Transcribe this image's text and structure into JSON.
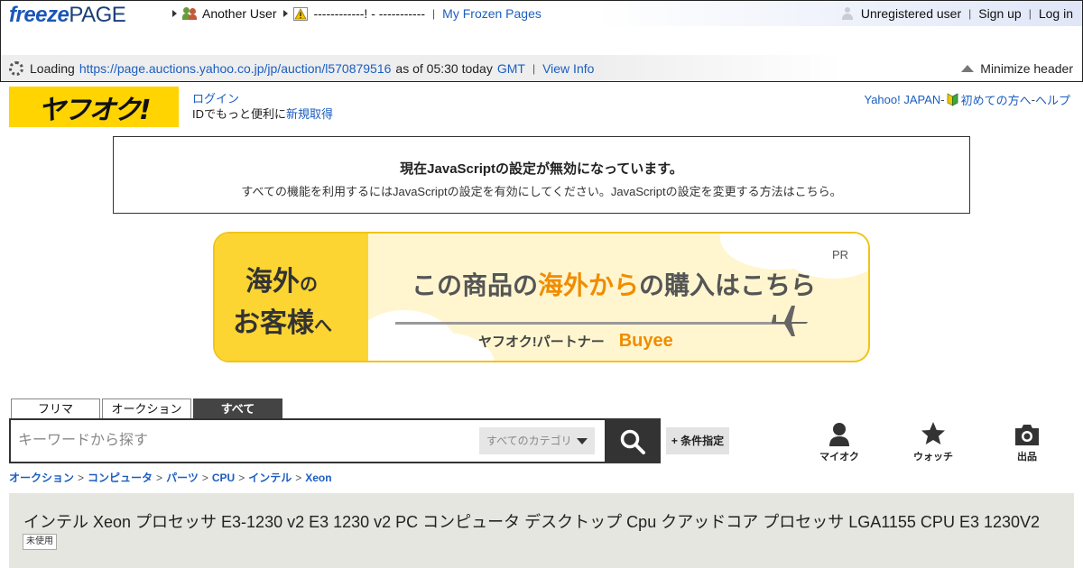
{
  "freezepage": {
    "logo_part1": "freeze",
    "logo_part2": "PAGE",
    "crumbs": {
      "user": "Another User",
      "page": "------------! - -----------",
      "frozen_pages": "My Frozen Pages"
    },
    "account": {
      "status": "Unregistered user",
      "signup": "Sign up",
      "login": "Log in"
    },
    "loading": {
      "prefix": "Loading",
      "url": "https://page.auctions.yahoo.co.jp/jp/auction/l570879516",
      "as_of": "as of 05:30 today",
      "tz": "GMT",
      "view_info": "View Info"
    },
    "minimize": "Minimize header"
  },
  "yahoo": {
    "logo": "ヤフオク!",
    "login_link": "ログイン",
    "login_text": "IDでもっと便利に",
    "register_link": "新規取得",
    "right": {
      "yahoo_japan": "Yahoo! JAPAN",
      "dash1": " - ",
      "beginner": "初めての方へ",
      "dash2": " - ",
      "help": "ヘルプ"
    }
  },
  "js_notice": {
    "title": "現在JavaScriptの設定が無効になっています。",
    "text": "すべての機能を利用するにはJavaScriptの設定を有効にしてください。JavaScriptの設定を変更する方法はこちら。"
  },
  "banner": {
    "left1_a": "海外",
    "left1_b": "の",
    "left2_a": "お客様",
    "left2_b": "へ",
    "main_a": "この商品の",
    "main_hl": "海外から",
    "main_b": "の購入はこちら",
    "partner": "ヤフオク!パートナー",
    "buyee": "Buyee",
    "pr": "PR"
  },
  "search": {
    "tabs": [
      "フリマ",
      "オークション",
      "すべて"
    ],
    "placeholder": "キーワードから探す",
    "category": "すべてのカテゴリ",
    "conditions": "+ 条件指定"
  },
  "nav": {
    "myauc": "マイオク",
    "watch": "ウォッチ",
    "sell": "出品"
  },
  "breadcrumb": [
    "オークション",
    "コンピュータ",
    "パーツ",
    "CPU",
    "インテル",
    "Xeon"
  ],
  "item": {
    "title": "インテル Xeon プロセッサ E3-1230 v2 E3 1230 v2 PC コンピュータ デスクトップ Cpu クアッドコア プロセッサ LGA1155 CPU E3 1230V2",
    "condition": "未使用"
  },
  "colors": {
    "link": "#1b5ec0",
    "yahoo_yellow": "#ffd400",
    "banner_orange": "#f08c00"
  }
}
